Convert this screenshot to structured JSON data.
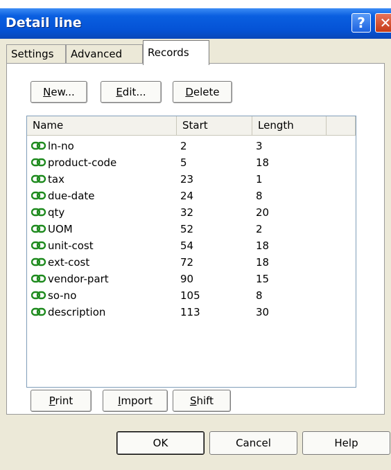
{
  "window": {
    "title": "Detail line",
    "help_glyph": "?",
    "close_glyph": "✕"
  },
  "tabs": [
    {
      "label": "Settings"
    },
    {
      "label": "Advanced"
    },
    {
      "label": "Records"
    }
  ],
  "toolbar": {
    "new_label": "New...",
    "edit_label": "Edit...",
    "delete_label": "Delete"
  },
  "list": {
    "columns": [
      "Name",
      "Start",
      "Length"
    ],
    "rows": [
      {
        "name": "ln-no",
        "start": "2",
        "length": "3"
      },
      {
        "name": "product-code",
        "start": "5",
        "length": "18"
      },
      {
        "name": "tax",
        "start": "23",
        "length": "1"
      },
      {
        "name": "due-date",
        "start": "24",
        "length": "8"
      },
      {
        "name": "qty",
        "start": "32",
        "length": "20"
      },
      {
        "name": "UOM",
        "start": "52",
        "length": "2"
      },
      {
        "name": "unit-cost",
        "start": "54",
        "length": "18"
      },
      {
        "name": "ext-cost",
        "start": "72",
        "length": "18"
      },
      {
        "name": "vendor-part",
        "start": "90",
        "length": "15"
      },
      {
        "name": "so-no",
        "start": "105",
        "length": "8"
      },
      {
        "name": "description",
        "start": "113",
        "length": "30"
      }
    ],
    "row_icon": "link-icon",
    "row_icon_color": "#1e8a1e"
  },
  "actions": {
    "print_label": "Print",
    "import_label": "Import",
    "shift_label": "Shift"
  },
  "footer": {
    "ok_label": "OK",
    "cancel_label": "Cancel",
    "help_label": "Help"
  }
}
